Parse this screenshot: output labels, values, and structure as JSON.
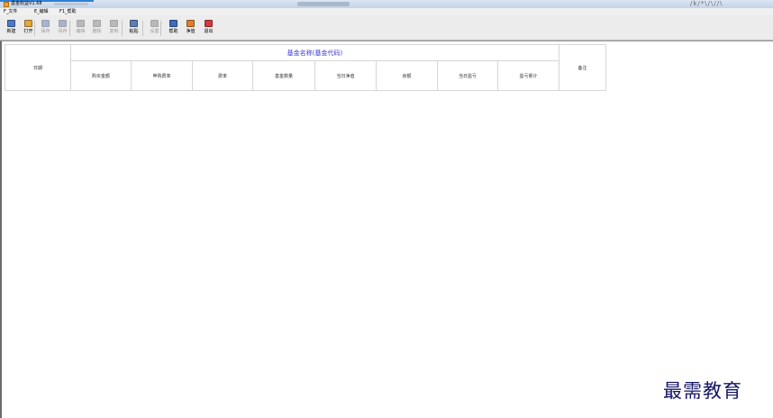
{
  "window": {
    "title": "基金收益V1.68",
    "corner_text": "/k/*\\/\\//\\"
  },
  "menu": [
    {
      "label": "F_文件"
    },
    {
      "label": "E_编辑"
    },
    {
      "label": "F1_帮助"
    }
  ],
  "toolbar": [
    {
      "label": "新建",
      "icon": "new-file-icon",
      "enabled": true,
      "color": "#4a79c8"
    },
    {
      "label": "打开",
      "icon": "open-folder-icon",
      "enabled": true,
      "color": "#e2a63c"
    },
    {
      "label": "保存",
      "icon": "save-icon",
      "enabled": false,
      "color": "#5a6fa8"
    },
    {
      "label": "另存",
      "icon": "save-as-icon",
      "enabled": false,
      "color": "#5a6fa8"
    },
    {
      "label": "编辑",
      "icon": "edit-icon",
      "enabled": false,
      "color": "#7c7c7c"
    },
    {
      "label": "删除",
      "icon": "delete-icon",
      "enabled": false,
      "color": "#7c7c7c"
    },
    {
      "label": "复制",
      "icon": "copy-icon",
      "enabled": false,
      "color": "#7c7c7c"
    },
    {
      "label": "粘贴",
      "icon": "paste-icon",
      "enabled": true,
      "color": "#5d7fb8"
    },
    {
      "label": "设置",
      "icon": "settings-icon",
      "enabled": false,
      "color": "#7c7c7c"
    },
    {
      "label": "帮助",
      "icon": "help-book-icon",
      "enabled": true,
      "color": "#3c6cc0"
    },
    {
      "label": "净值",
      "icon": "flag-icon",
      "enabled": true,
      "color": "#d8802a"
    },
    {
      "label": "退出",
      "icon": "exit-icon",
      "enabled": true,
      "color": "#d23a3a"
    }
  ],
  "table": {
    "date_header": "日期",
    "fund_header": "基金名称(基金代码)",
    "note_header": "备注",
    "columns": [
      "购买金额",
      "申购费率",
      "费率",
      "基金数量",
      "当日净值",
      "余额",
      "当日盈亏",
      "盈亏累计"
    ]
  },
  "watermark": "最需教育"
}
